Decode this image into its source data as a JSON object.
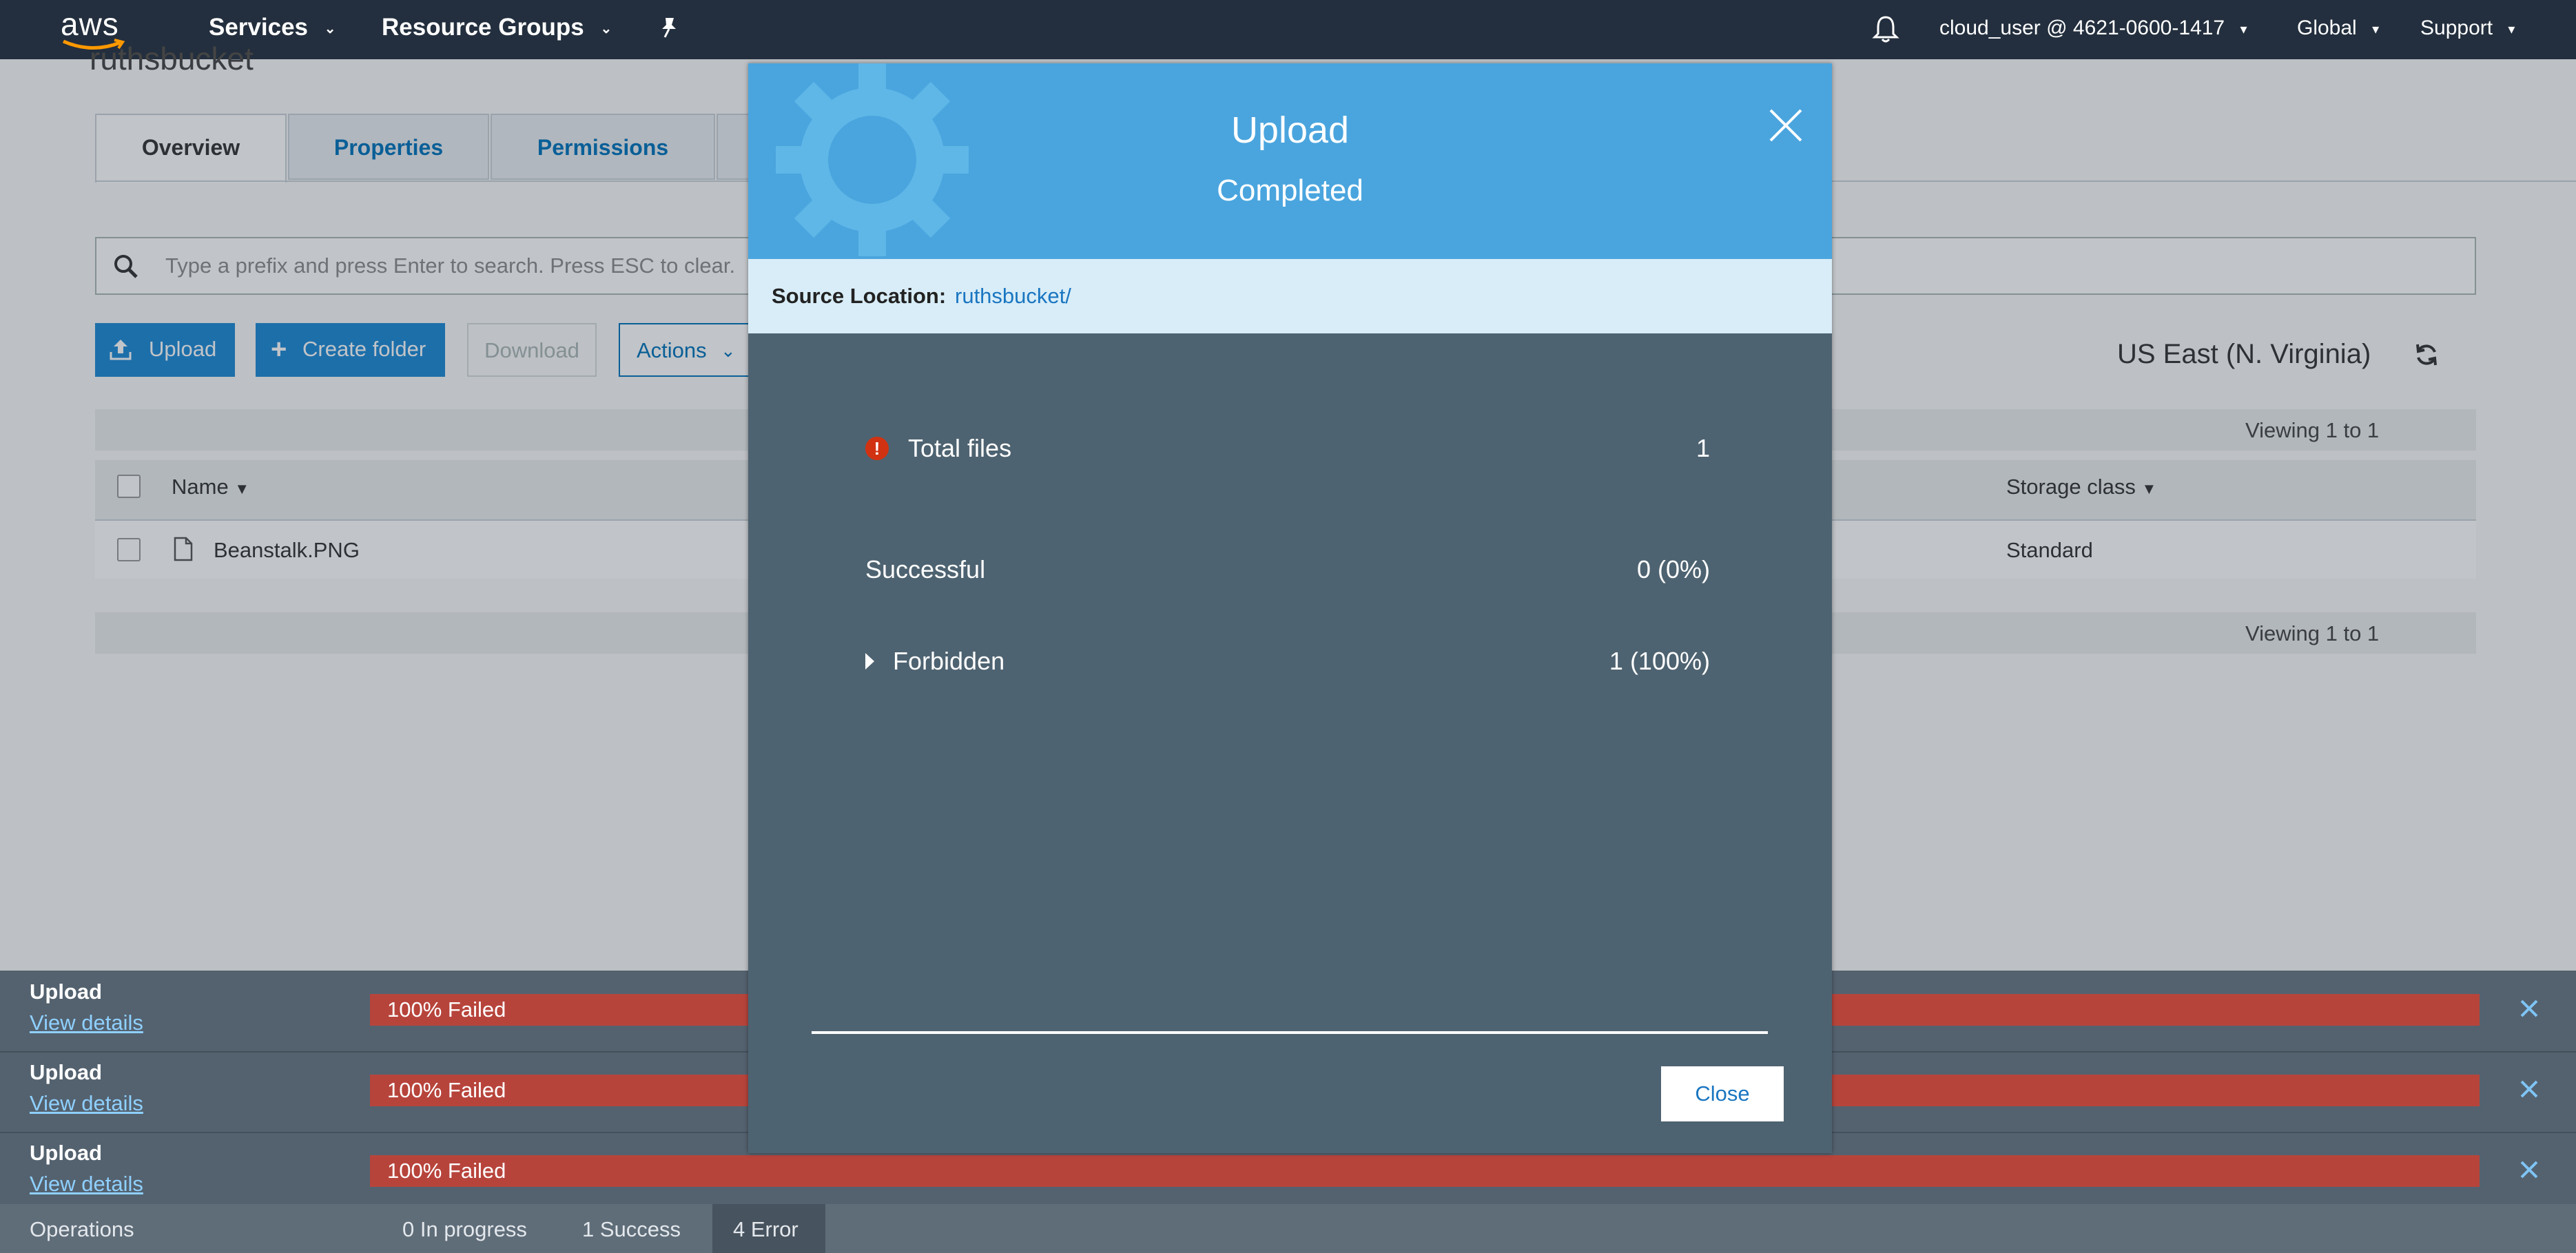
{
  "nav": {
    "logo": "aws",
    "services": "Services",
    "resource_groups": "Resource Groups",
    "account": "cloud_user @ 4621-0600-1417",
    "region": "Global",
    "support": "Support",
    "icons": [
      "bell-icon",
      "pin-icon",
      "chevron-down-icon"
    ]
  },
  "bucket": {
    "title": "ruthsbucket",
    "tabs": [
      "Overview",
      "Properties",
      "Permissions"
    ],
    "search_placeholder": "Type a prefix and press Enter to search. Press ESC to clear.",
    "buttons": {
      "upload": "Upload",
      "create_folder": "Create folder",
      "download": "Download",
      "actions": "Actions"
    },
    "region_label": "US East (N. Virginia)",
    "viewing_top": "Viewing 1 to 1",
    "viewing_bottom": "Viewing 1 to 1",
    "columns": {
      "name": "Name",
      "storage_class": "Storage class"
    },
    "rows": [
      {
        "name": "Beanstalk.PNG",
        "storage_class": "Standard"
      }
    ]
  },
  "operations": {
    "items": [
      {
        "label": "Upload",
        "link": "View details",
        "status": "100% Failed",
        "progress": 1.0,
        "color": "#b7443b"
      },
      {
        "label": "Upload",
        "link": "View details",
        "status": "100% Failed",
        "progress": 1.0,
        "color": "#b7443b"
      },
      {
        "label": "Upload",
        "link": "View details",
        "status": "100% Failed",
        "progress": 1.0,
        "color": "#b7443b"
      }
    ],
    "footer": {
      "title": "Operations",
      "in_progress": "0 In progress",
      "success": "1 Success",
      "error": "4 Error"
    }
  },
  "modal": {
    "title": "Upload",
    "subtitle": "Completed",
    "source_label": "Source Location:",
    "source_value": "ruthsbucket/",
    "total_files_label": "Total files",
    "total_files_value": "1",
    "successful_label": "Successful",
    "successful_value": "0 (0%)",
    "forbidden_label": "Forbidden",
    "forbidden_value": "1 (100%)",
    "close_button": "Close",
    "header_color": "#4aa5de",
    "error_color": "#d13212"
  }
}
